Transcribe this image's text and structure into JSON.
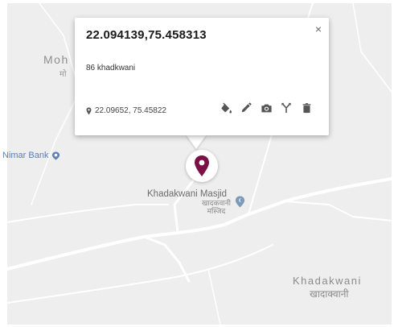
{
  "map": {
    "labels": {
      "moh": "Moh",
      "moh_hindi": "मो",
      "nimar_bank": "Nimar Bank",
      "masjid": "Khadakwani Masjid",
      "masjid_hindi": "खादकवानी मस्जिद",
      "khadakwani": "Khadakwani",
      "khadakwani_hindi": "खादाक्वानी"
    },
    "colors": {
      "background": "#eeeeee",
      "road": "#ffffff",
      "poi": "#5d7fb5",
      "marker": "#7a1046"
    }
  },
  "infowindow": {
    "title": "22.094139,75.458313",
    "description": "86 khadkwani",
    "coordinates": "22.09652, 75.45822",
    "close_glyph": "×",
    "tools": [
      "paint-bucket-icon",
      "pencil-icon",
      "camera-icon",
      "route-icon",
      "trash-icon"
    ]
  }
}
